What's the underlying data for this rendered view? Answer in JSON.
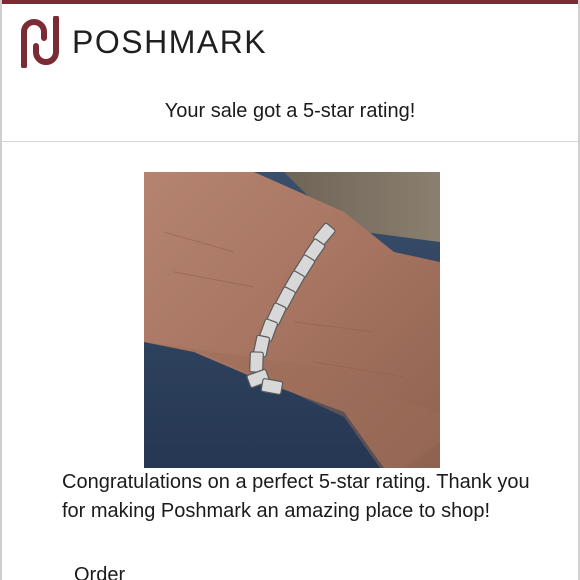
{
  "brand": {
    "name": "POSHMARK",
    "accent_color": "#7a2b34",
    "logo_icon": "poshmark-logo-icon"
  },
  "email": {
    "subject_line": "Your sale got a 5-star rating!",
    "product_image": "bracelet-on-wrist-photo",
    "message": "Congratulations on a perfect 5-star rating. Thank you for making Poshmark an amazing place to shop!",
    "order_label": "Order"
  }
}
